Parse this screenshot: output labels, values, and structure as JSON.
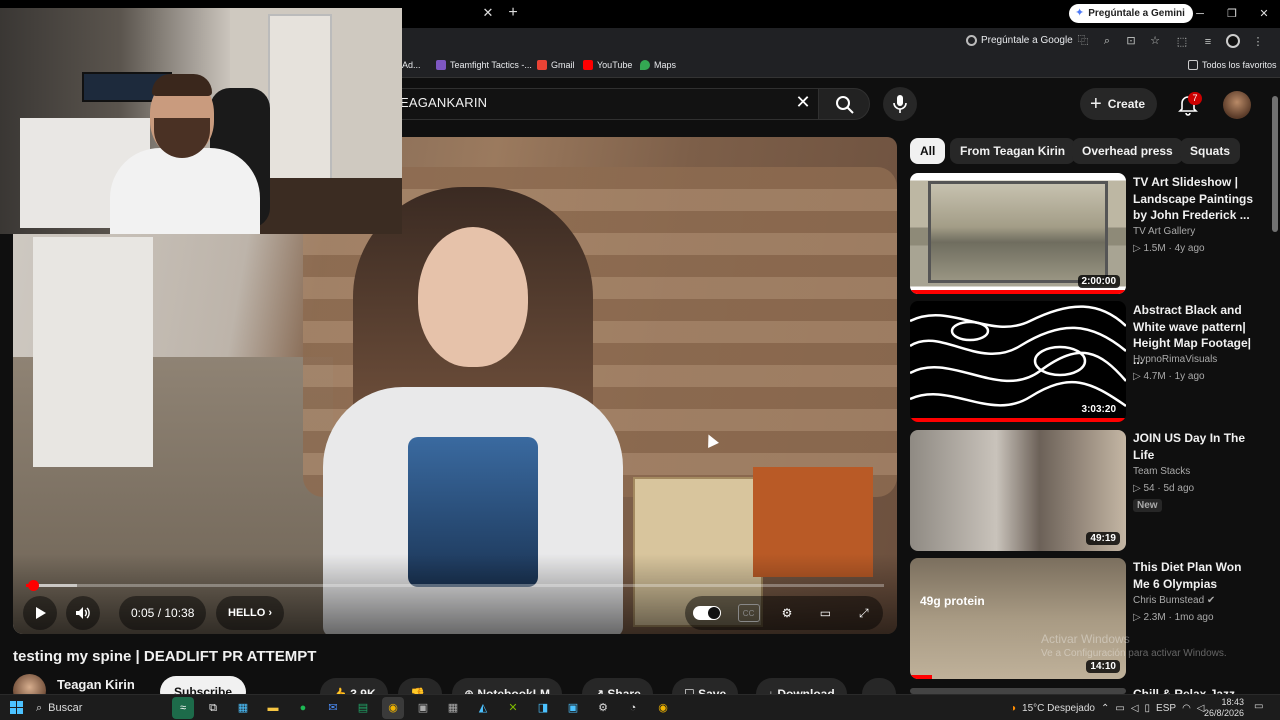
{
  "browser": {
    "gemini_button": "Pregúntale a Gemini",
    "ask_google": "Pregúntale a Google",
    "bookmarks": [
      {
        "label": "Ad...",
        "color": "#888888"
      },
      {
        "label": "Teamfight Tactics -...",
        "color": "#7e57c2"
      },
      {
        "label": "Gmail",
        "color": "#ea4335"
      },
      {
        "label": "YouTube",
        "color": "#ff0000"
      },
      {
        "label": "Maps",
        "color": "#34a853"
      }
    ],
    "all_favorites": "Todos los favoritos"
  },
  "youtube": {
    "search_query": "EAGANKARIN",
    "create_label": "Create",
    "notification_count": "7"
  },
  "player": {
    "time": "0:05 / 10:38",
    "chapter": "HELLO",
    "progress_fraction": 0.008,
    "buffer_fraction": 0.06
  },
  "video": {
    "title": "testing my spine | DEADLIFT PR ATTEMPT",
    "channel": "Teagan Kirin",
    "subscribe": "Subscribe",
    "actions": [
      "3.9K",
      "",
      "NotebookLM",
      "Share",
      "Save",
      "Download",
      "..."
    ]
  },
  "chips": [
    "All",
    "From Teagan Kirin",
    "Overhead press",
    "Squats"
  ],
  "recommendations": [
    {
      "title": "TV Art Slideshow | Landscape Paintings by John Frederick ...",
      "channel": "TV Art Gallery",
      "meta": "1.5M · 4y ago",
      "duration": "2:00:00",
      "progress": 1.0,
      "badge": ""
    },
    {
      "title": "Abstract Black and White wave pattern| Height Map Footage| ...",
      "channel": "HypnoRimaVisuals",
      "meta": "4.7M · 1y ago",
      "duration": "3:03:20",
      "progress": 1.0,
      "badge": ""
    },
    {
      "title": "JOIN US Day In The Life",
      "channel": "Team Stacks",
      "meta": "54 · 5d ago",
      "duration": "49:19",
      "progress": 0,
      "badge": "New"
    },
    {
      "title": "This Diet Plan Won Me 6 Olympias",
      "channel": "Chris Bumstead",
      "meta": "2.3M · 1mo ago",
      "duration": "14:10",
      "progress": 0.1,
      "badge": "",
      "thumb_text": "49g protein"
    },
    {
      "title": "Chill & Relax Jazz ...",
      "channel": "",
      "meta": "",
      "duration": "",
      "progress": 0,
      "badge": ""
    }
  ],
  "windows": {
    "watermark_title": "Activar Windows",
    "watermark_sub": "Ve a Configuración para activar Windows.",
    "search_label": "Buscar",
    "weather": "15°C  Despejado",
    "language": "ESP",
    "time": "18:43",
    "date": "26/8/2026"
  }
}
